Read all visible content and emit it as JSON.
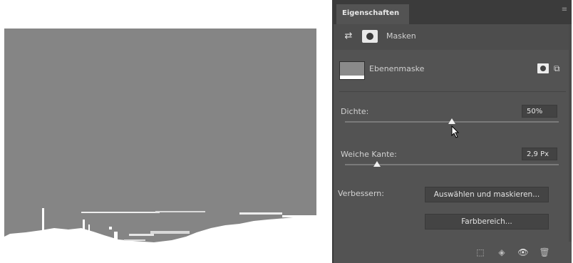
{
  "panel": {
    "tab_label": "Eigenschaften",
    "menu_icon": "panel-menu-icon",
    "mode_label": "Masken",
    "layer_label": "Ebenenmaske",
    "density_label": "Dichte:",
    "density_value": "50%",
    "density_level": 0.5,
    "feather_label": "Weiche Kante:",
    "feather_value": "2,9 Px",
    "feather_level": 0.01,
    "refine_label": "Verbessern:",
    "select_mask_button": "Auswählen und maskieren...",
    "color_range_button": "Farbbereich...",
    "icons": [
      "pixel-mask-icon",
      "vector-mask-icon",
      "load-selection-icon",
      "apply-mask-icon",
      "visibility-icon",
      "trash-icon"
    ]
  },
  "colors": {
    "panel_bg": "#535353",
    "canvas_gray": "#858585",
    "mask_white": "#ffffff"
  }
}
